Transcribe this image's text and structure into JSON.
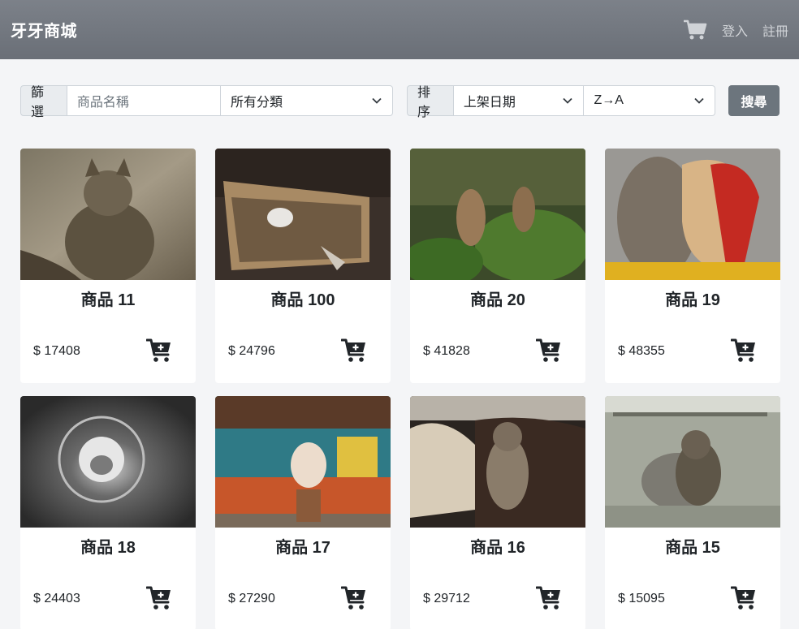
{
  "header": {
    "brand": "牙牙商城",
    "login": "登入",
    "register": "註冊"
  },
  "filter": {
    "label": "篩選",
    "name_placeholder": "商品名稱",
    "category": "所有分類"
  },
  "sort": {
    "label": "排序",
    "field": "上架日期",
    "order": "Z→A"
  },
  "search_button": "搜尋",
  "products": [
    {
      "title": "商品 11",
      "price": "$ 17408"
    },
    {
      "title": "商品 100",
      "price": "$ 24796"
    },
    {
      "title": "商品 20",
      "price": "$ 41828"
    },
    {
      "title": "商品 19",
      "price": "$ 48355"
    },
    {
      "title": "商品 18",
      "price": "$ 24403"
    },
    {
      "title": "商品 17",
      "price": "$ 27290"
    },
    {
      "title": "商品 16",
      "price": "$ 29712"
    },
    {
      "title": "商品 15",
      "price": "$ 15095"
    }
  ],
  "colors": {
    "navbar": "#6c757d",
    "button": "#6c757d",
    "page_bg": "#f4f5f7"
  }
}
